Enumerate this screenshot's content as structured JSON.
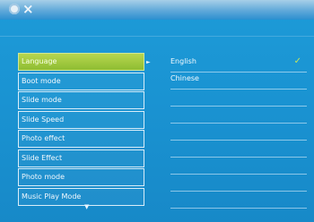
{
  "menu": {
    "items": [
      {
        "label": "Language",
        "selected": true
      },
      {
        "label": "Boot mode",
        "selected": false
      },
      {
        "label": "Slide mode",
        "selected": false
      },
      {
        "label": "Slide Speed",
        "selected": false
      },
      {
        "label": "Photo effect",
        "selected": false
      },
      {
        "label": "Slide Effect",
        "selected": false
      },
      {
        "label": "Photo mode",
        "selected": false
      },
      {
        "label": "Music Play Mode",
        "selected": false
      }
    ]
  },
  "options": {
    "items": [
      {
        "label": "English",
        "checked": true
      },
      {
        "label": "Chinese",
        "checked": false
      }
    ],
    "empty_rows": 7
  },
  "icons": {
    "top_left": [
      "gear-icon",
      "close-icon"
    ],
    "check": "check-icon",
    "scroll_down": "chevron-down-icon"
  },
  "colors": {
    "background": "#1a93d2",
    "selected": "#a5cf3f",
    "border": "#d9edf9"
  }
}
